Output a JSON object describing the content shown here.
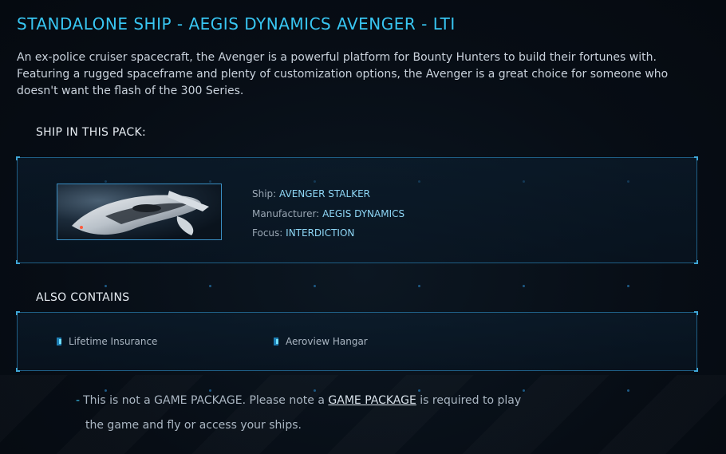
{
  "header": {
    "title": "STANDALONE SHIP - AEGIS DYNAMICS AVENGER - LTI",
    "description": "An ex-police cruiser spacecraft, the Avenger is a powerful platform for Bounty Hunters to build their fortunes with. Featuring a rugged spaceframe and plenty of customization options, the Avenger is a great choice for someone who doesn't want the flash of the 300 Series."
  },
  "ships_section": {
    "label": "SHIP IN THIS PACK:",
    "ship": {
      "ship_key": "Ship:",
      "ship_value": "AVENGER STALKER",
      "manufacturer_key": "Manufacturer:",
      "manufacturer_value": "AEGIS DYNAMICS",
      "focus_key": "Focus:",
      "focus_value": "INTERDICTION"
    }
  },
  "contains_section": {
    "label": "ALSO CONTAINS",
    "items": [
      "Lifetime Insurance",
      "Aeroview Hangar"
    ]
  },
  "note": {
    "dash": "-",
    "text_before": "This is not a GAME PACKAGE. Please note a ",
    "link": "GAME PACKAGE",
    "text_after": " is required to play",
    "line2": "the game and fly or access your ships."
  },
  "colors": {
    "accent": "#38c6f2",
    "panel_border": "#1f5f86",
    "value_text": "#8ed6f5"
  }
}
